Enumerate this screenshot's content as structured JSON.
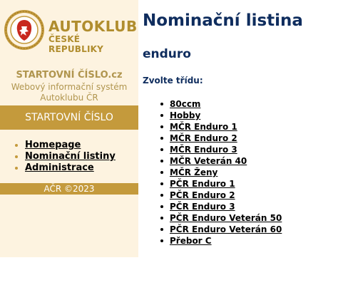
{
  "logo": {
    "line1": "AUTOKLUB",
    "line2": "ČESKÉ REPUBLIKY",
    "seal_text": "AUTOKLUB ČESKÉ REPUBLIKY 1904"
  },
  "sidebar": {
    "site_name": "STARTOVNÍ ČÍSLO.cz",
    "description": "Webový informační systém Autoklubu ČR",
    "section_title": "STARTOVNÍ ČÍSLO",
    "nav": [
      {
        "label": "Homepage"
      },
      {
        "label": "Nominační listiny"
      },
      {
        "label": "Administrace"
      }
    ],
    "footer": "AČR ©2023"
  },
  "main": {
    "title": "Nominační listina",
    "subtitle": "enduro",
    "choose_label": "Zvolte třídu:",
    "classes": [
      "80ccm",
      "Hobby",
      "MČR Enduro 1",
      "MČR Enduro 2",
      "MČR Enduro 3",
      "MČR Veterán 40",
      "MČR Ženy",
      "PČR Enduro 1",
      "PČR Enduro 2",
      "PČR Enduro 3",
      "PČR Enduro Veterán 50",
      "PČR Enduro Veterán 60",
      "Přebor C"
    ]
  },
  "colors": {
    "accent": "#c49a3c",
    "sidebar_bg": "#fdf3e0",
    "title": "#0f2d5e",
    "seal_red": "#c8281e"
  }
}
